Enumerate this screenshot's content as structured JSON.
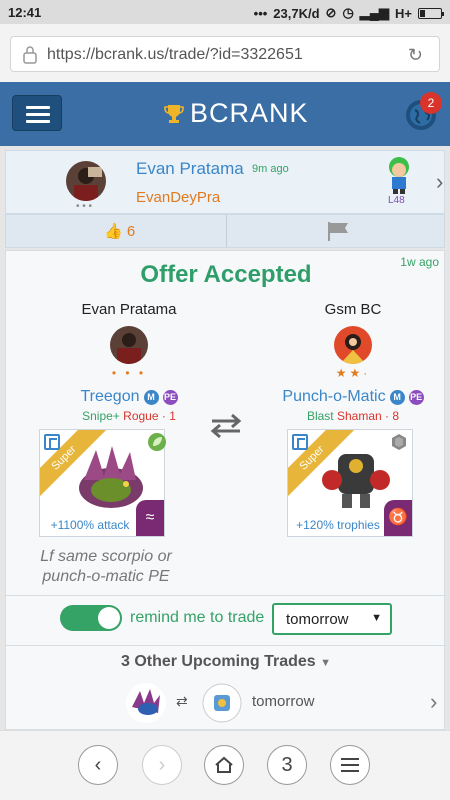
{
  "status_bar": {
    "time": "12:41",
    "network_speed": "23,7K/d",
    "network_type": "H+"
  },
  "browser": {
    "url": "https://bcrank.us/trade/?id=3322651"
  },
  "app": {
    "brand": "BCRANK",
    "notification_count": "2"
  },
  "user_card": {
    "name": "Evan Pratama",
    "time_ago": "9m ago",
    "handle": "EvanDeyPra",
    "level": "L48",
    "dots": "• • •"
  },
  "actions": {
    "likes": "6"
  },
  "offer": {
    "time_ago": "1w ago",
    "title": "Offer Accepted",
    "left": {
      "trader": "Evan Pratama",
      "rank_dots": "• • •",
      "monster": "Treegon",
      "badge_m": "M",
      "badge_pe": "PE",
      "trait": "Snipe+",
      "role": "Rogue",
      "level": "· 1",
      "ribbon": "Super",
      "stat": "+1100% attack",
      "element_icon": "leaf-icon",
      "zodiac_symbol": "≈"
    },
    "right": {
      "trader": "Gsm BC",
      "rank_stars": "★★·",
      "monster": "Punch-o-Matic",
      "badge_m": "M",
      "badge_pe": "PE",
      "trait": "Blast",
      "role": "Shaman",
      "level": "· 8",
      "ribbon": "Super",
      "stat": "+120% trophies",
      "element_icon": "metal-icon",
      "zodiac_symbol": "♉"
    },
    "note": "Lf same scorpio or punch-o-matic PE"
  },
  "reminder": {
    "label": "remind me to trade",
    "selected": "tomorrow",
    "enabled": true
  },
  "upcoming": {
    "title": "3 Other Upcoming Trades",
    "first_when": "tomorrow"
  },
  "bottom_nav": {
    "tabs_count": "3"
  },
  "colors": {
    "header": "#3b6ea5",
    "accent_green": "#35a266",
    "link_blue": "#3a86c8",
    "orange": "#e07b20",
    "red": "#d9342b"
  }
}
